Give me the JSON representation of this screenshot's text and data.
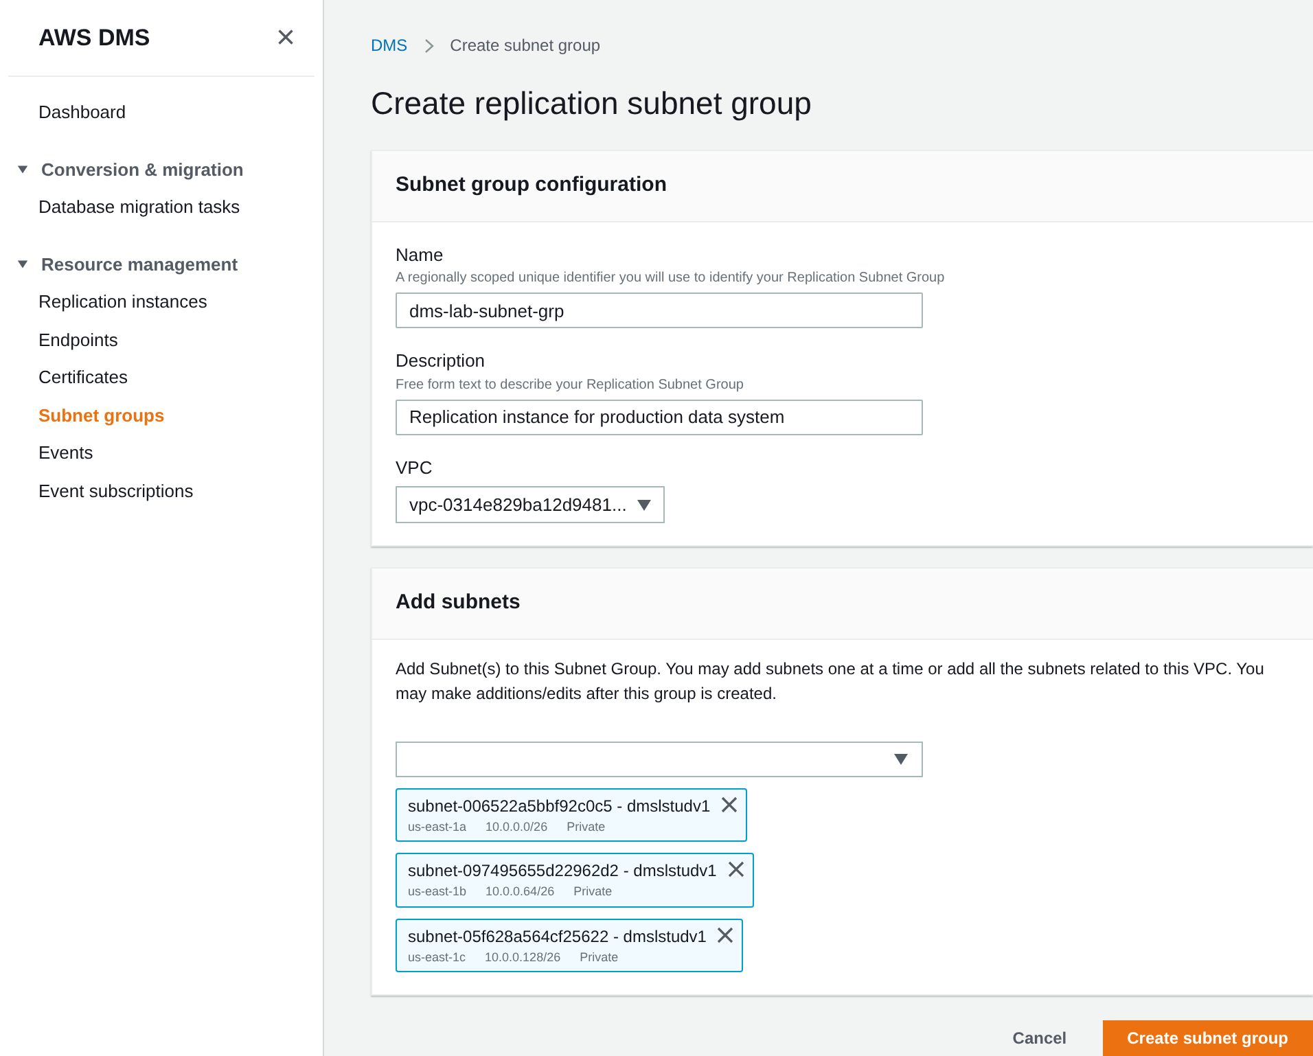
{
  "sidebar": {
    "title": "AWS DMS",
    "close_icon": "×",
    "items": [
      {
        "kind": "link",
        "label": "Dashboard",
        "selected": false
      },
      {
        "kind": "section",
        "label": "Conversion & migration",
        "expanded": true,
        "children": [
          {
            "label": "Database migration tasks",
            "selected": false
          }
        ]
      },
      {
        "kind": "section",
        "label": "Resource management",
        "expanded": true,
        "children": [
          {
            "label": "Replication instances",
            "selected": false
          },
          {
            "label": "Endpoints",
            "selected": false
          },
          {
            "label": "Certificates",
            "selected": false
          },
          {
            "label": "Subnet groups",
            "selected": true
          },
          {
            "label": "Events",
            "selected": false
          },
          {
            "label": "Event subscriptions",
            "selected": false
          }
        ]
      }
    ]
  },
  "breadcrumbs": [
    "DMS",
    "Create subnet group"
  ],
  "page_title": "Create replication subnet group",
  "config_panel": {
    "title": "Subnet group configuration",
    "fields": [
      {
        "kind": "text",
        "label": "Name",
        "hint": "A regionally scoped unique identifier you will use to identify your Replication Subnet Group",
        "value": "dms-lab-subnet-grp"
      },
      {
        "kind": "text",
        "label": "Description",
        "hint": "Free form text to describe your Replication Subnet Group",
        "value": "Replication instance for production data system"
      },
      {
        "kind": "select",
        "label": "VPC",
        "value": "vpc-0314e829ba12d9481..."
      }
    ]
  },
  "subnets_panel": {
    "title": "Add subnets",
    "description": "Add Subnet(s) to this Subnet Group. You may add subnets one at a time or add all the subnets related to this VPC. You may make additions/edits after this group is created.",
    "selected_subnets": [
      {
        "name": "subnet-006522a5bbf92c0c5 - dmslstudv1",
        "zone": "us-east-1a",
        "cidr": "10.0.0.0/26",
        "type": "Private"
      },
      {
        "name": "subnet-097495655d22962d2 - dmslstudv1",
        "zone": "us-east-1b",
        "cidr": "10.0.0.64/26",
        "type": "Private"
      },
      {
        "name": "subnet-05f628a564cf25622 - dmslstudv1",
        "zone": "us-east-1c",
        "cidr": "10.0.0.128/26",
        "type": "Private"
      }
    ]
  },
  "buttons": [
    {
      "kind": "secondary",
      "label": "Cancel"
    },
    {
      "kind": "primary",
      "label": "Create subnet group"
    }
  ]
}
